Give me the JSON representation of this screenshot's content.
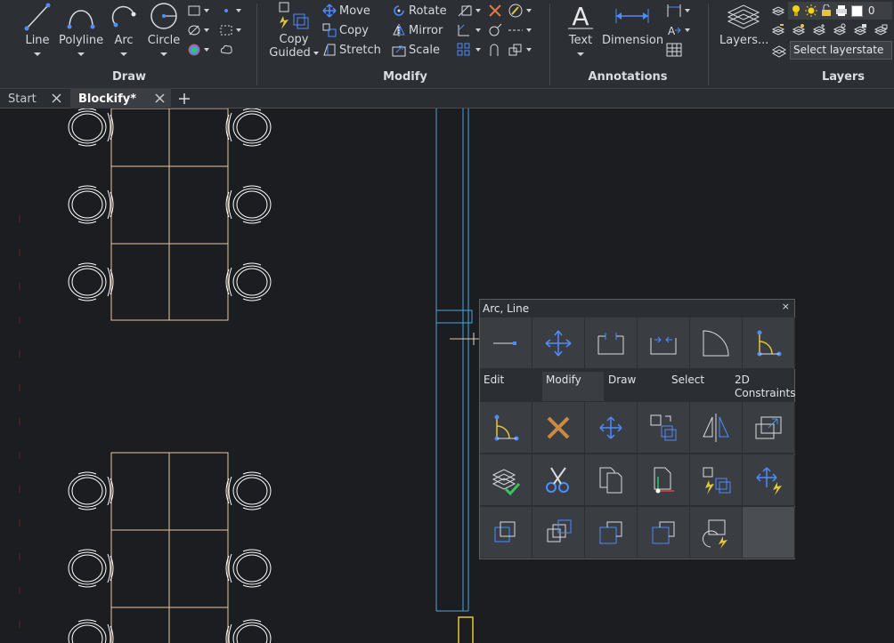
{
  "ribbon": {
    "groups": {
      "draw": "Draw",
      "modify": "Modify",
      "annotations": "Annotations",
      "layers": "Layers"
    },
    "draw_tools": {
      "line": "Line",
      "polyline": "Polyline",
      "arc": "Arc",
      "circle": "Circle"
    },
    "modify_tools": {
      "copy_guided_1": "Copy",
      "copy_guided_2": "Guided",
      "move": "Move",
      "copy": "Copy",
      "stretch": "Stretch",
      "rotate": "Rotate",
      "mirror": "Mirror",
      "scale": "Scale"
    },
    "annotation_tools": {
      "text": "Text",
      "dimension": "Dimension"
    },
    "layer_tools": {
      "layers": "Layers...",
      "layer_value": "0",
      "layerstate_placeholder": "Select layerstate"
    }
  },
  "tabs": [
    {
      "label": "Start"
    },
    {
      "label": "Blockify*"
    }
  ],
  "quad": {
    "title": "Arc, Line",
    "close": "×",
    "tabs": [
      "Edit",
      "Modify",
      "Draw",
      "Select",
      "2D Constraints"
    ],
    "active_tab": "Modify"
  },
  "colors": {
    "accent_blue": "#4f8cff",
    "furniture": "#e8c6a2",
    "wall": "#4aa8d8",
    "yellow": "#e3c73a",
    "red": "#e04a3a",
    "green": "#34c759"
  }
}
